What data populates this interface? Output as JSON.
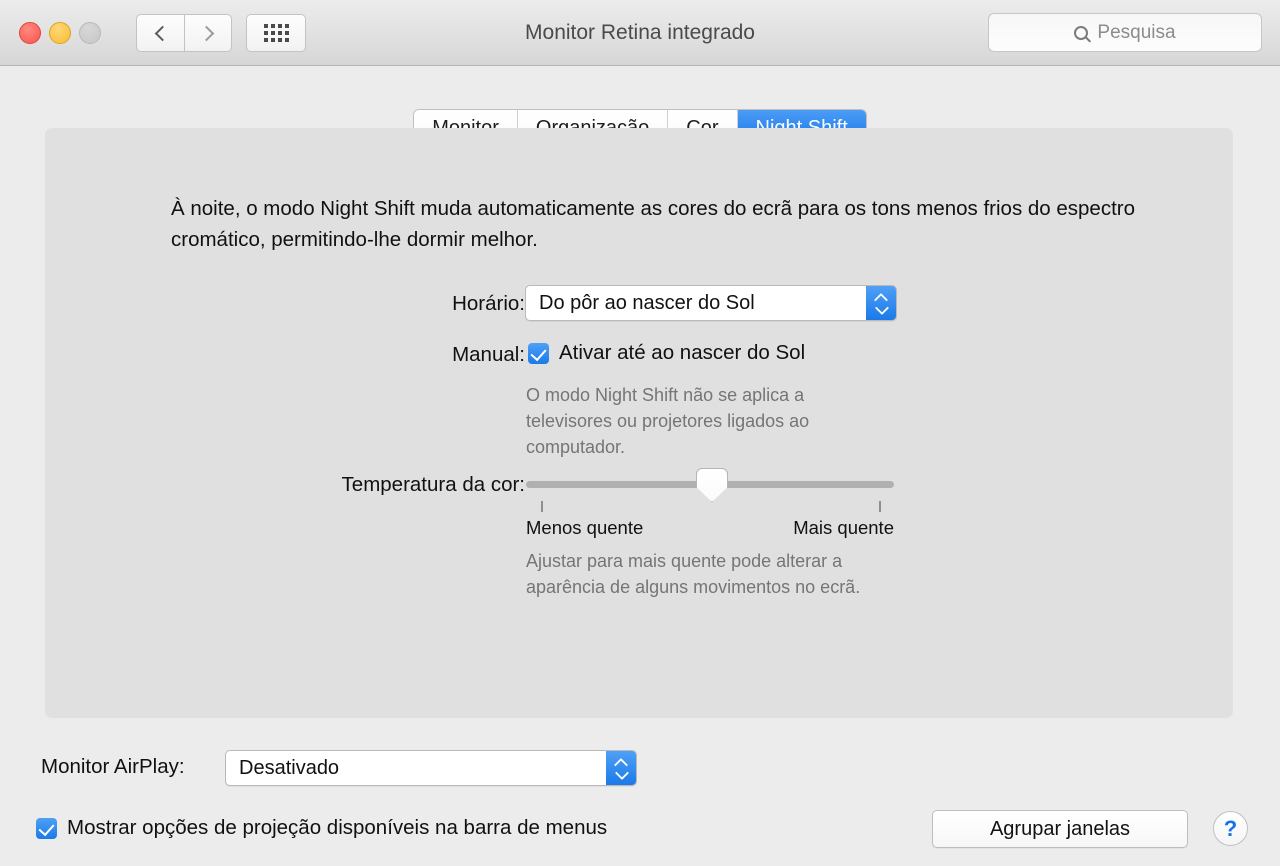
{
  "window": {
    "title": "Monitor Retina integrado",
    "traffic_lights": [
      "close-button",
      "minimize-button",
      "zoom-button"
    ],
    "nav": {
      "back": "back-icon",
      "forward": "forward-icon",
      "grid": "all-preferences-grid-icon"
    },
    "search": {
      "placeholder": "Pesquisa",
      "value": "",
      "icon": "search-icon"
    }
  },
  "tabs": [
    {
      "label": "Monitor",
      "active": false
    },
    {
      "label": "Organização",
      "active": false
    },
    {
      "label": "Cor",
      "active": false
    },
    {
      "label": "Night Shift",
      "active": true
    }
  ],
  "panel": {
    "description": "À noite, o modo Night Shift muda automaticamente as cores do ecrã para os tons menos frios do espectro cromático, permitindo-lhe dormir melhor.",
    "schedule": {
      "label": "Horário:",
      "value": "Do pôr ao nascer do Sol"
    },
    "manual": {
      "label": "Manual:",
      "checkbox_label": "Ativar até ao nascer do Sol",
      "checked": true,
      "hint": "O modo Night Shift não se aplica a televisores ou projetores ligados ao computador."
    },
    "temperature": {
      "label": "Temperatura da cor:",
      "min_label": "Menos quente",
      "max_label": "Mais quente",
      "value_percent": 47,
      "hint": "Ajustar para mais quente pode alterar a aparência de alguns movimentos no ecrã."
    }
  },
  "bottom": {
    "airplay": {
      "label": "Monitor AirPlay:",
      "value": "Desativado"
    },
    "menubar_checkbox": {
      "label": "Mostrar opções de projeção disponíveis na barra de menus",
      "checked": true
    },
    "gather_windows_button": "Agrupar janelas",
    "help_button": "?"
  },
  "colors": {
    "accent": "#1573e6",
    "window_bg": "#ececec",
    "panel_bg": "#e0e0e0",
    "hint_text": "#757575"
  }
}
